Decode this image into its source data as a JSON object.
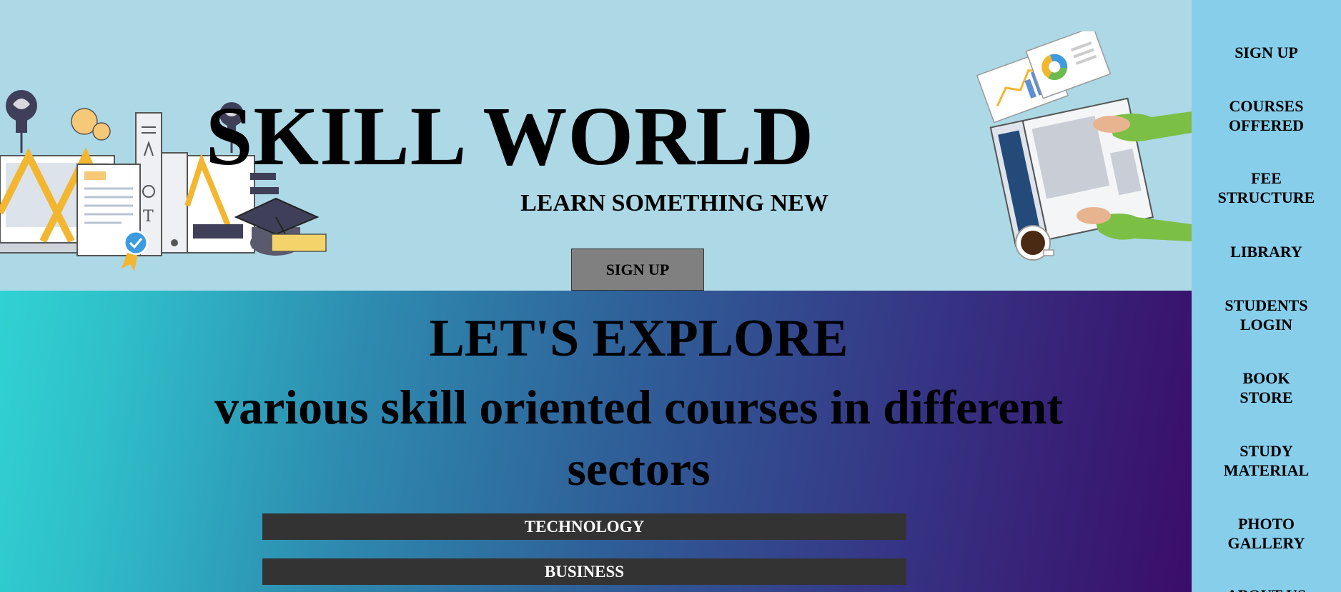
{
  "header": {
    "title": "SKILL WORLD",
    "tagline": "LEARN SOMETHING NEW",
    "signup_label": "SIGN UP"
  },
  "explore": {
    "title": "LET'S EXPLORE",
    "subtitle": "various skill oriented courses in different sectors",
    "categories": [
      "TECHNOLOGY",
      "BUSINESS"
    ]
  },
  "sidenav": {
    "items": [
      "SIGN UP",
      "COURSES\nOFFERED",
      "FEE\nSTRUCTURE",
      "LIBRARY",
      "STUDENTS\nLOGIN",
      "BOOK\nSTORE",
      "STUDY\nMATERIAL",
      "PHOTO\nGALLERY",
      "ABOUT US"
    ]
  },
  "colors": {
    "header_bg": "#add8e6",
    "nav_bg": "#87ceeb",
    "button_bg": "#808080",
    "category_bg": "#333333",
    "gradient_start": "#30d2d2",
    "gradient_end": "#3a0d6a"
  },
  "icons": [
    "education-illustration",
    "laptop-illustration"
  ]
}
